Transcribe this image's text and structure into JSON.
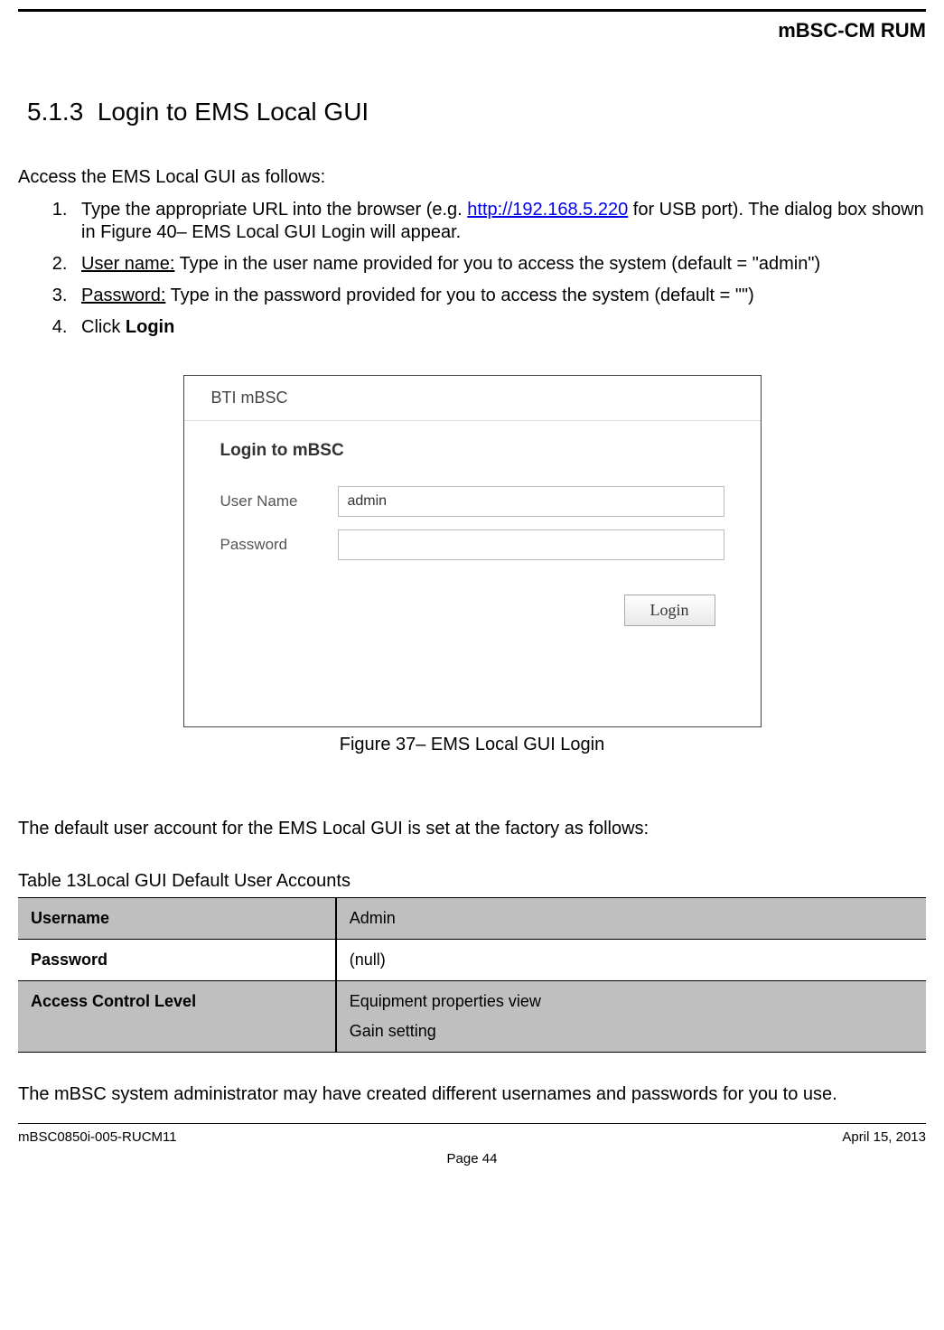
{
  "header": {
    "title": "mBSC-CM  RUM"
  },
  "section": {
    "number": "5.1.3",
    "title": "Login to EMS Local GUI"
  },
  "intro": "Access the EMS Local GUI as follows:",
  "steps": {
    "s1a": "Type the appropriate URL into the browser (e.g. ",
    "s1link": "http://192.168.5.220",
    "s1b": " for USB port). The dialog box shown in Figure 40– EMS Local GUI Login will appear.",
    "s2label": "User name:",
    "s2rest": " Type in the user name provided for you to access the system (default = \"admin\")",
    "s3label": "Password:",
    "s3rest": " Type in the password provided for you to access the system (default = \"\")",
    "s4a": "Click ",
    "s4b": "Login"
  },
  "login_box": {
    "window_title": "BTI mBSC",
    "subtitle": "Login to mBSC",
    "user_label": "User Name",
    "pass_label": "Password",
    "user_value": "admin",
    "pass_value": "",
    "button": "Login"
  },
  "figure_caption": "Figure 37– EMS Local GUI Login",
  "default_desc": "The default user account for the EMS Local GUI is set at the factory as follows:",
  "table_caption": "Table 13Local GUI Default User Accounts",
  "table": {
    "rows": [
      {
        "left": "Username",
        "right": "Admin"
      },
      {
        "left": "Password",
        "right": "(null)"
      },
      {
        "left": "Access Control Level",
        "right_lines": [
          "Equipment properties view",
          "Gain setting"
        ]
      }
    ]
  },
  "admin_note": "The mBSC system administrator may have created different usernames and passwords for you to use.",
  "footer": {
    "left": "mBSC0850i-005-RUCM11",
    "right": "April 15, 2013",
    "center": "Page 44"
  }
}
